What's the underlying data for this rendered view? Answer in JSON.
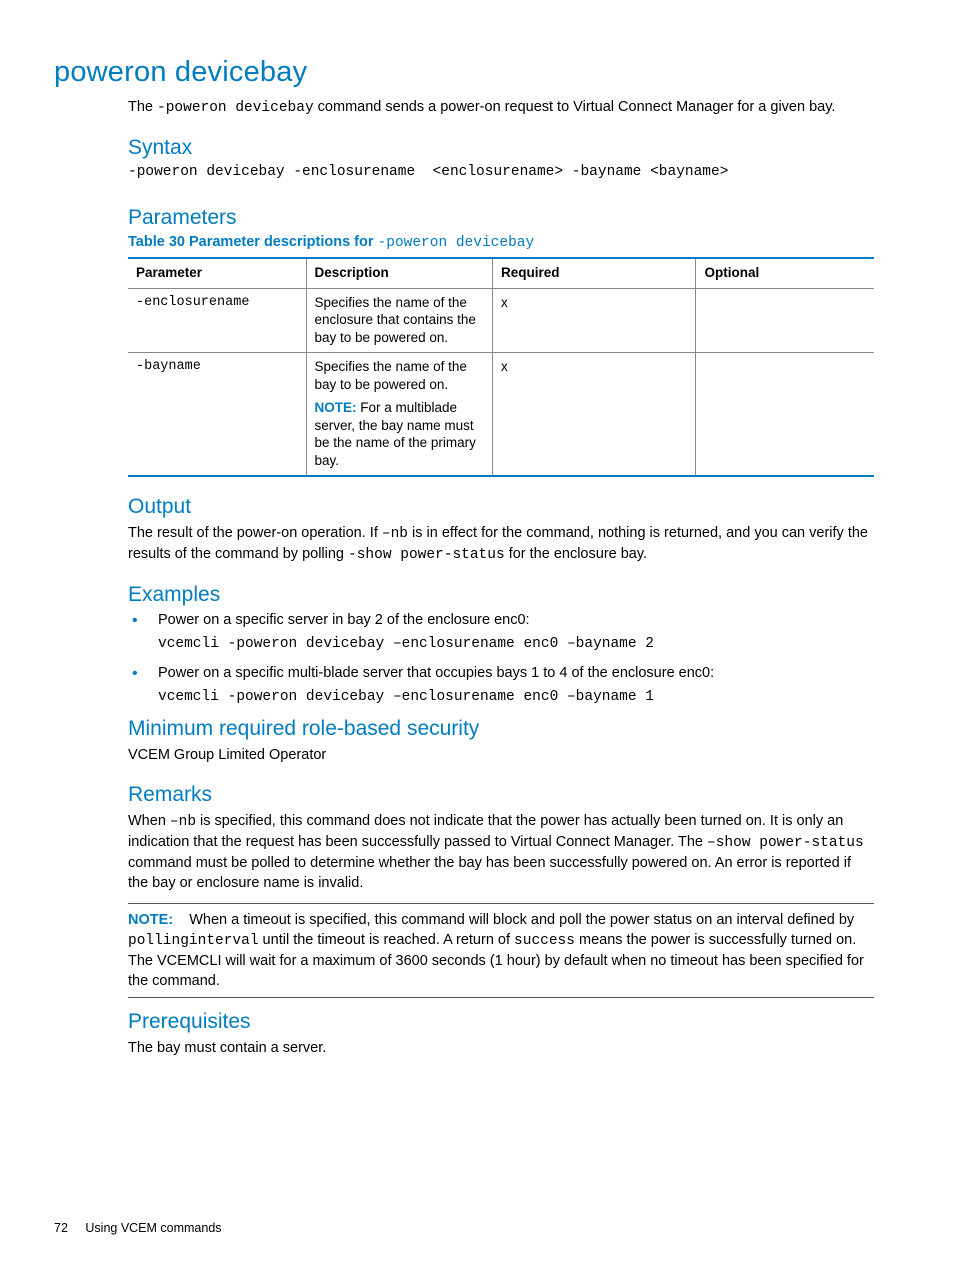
{
  "title": "poweron devicebay",
  "intro_pre": "The ",
  "intro_cmd": "-poweron devicebay",
  "intro_post": " command sends a power-on request to Virtual Connect Manager for a given bay.",
  "syntax": {
    "heading": "Syntax",
    "line": "-poweron devicebay -enclosurename  <enclosurename> -bayname <bayname>"
  },
  "parameters": {
    "heading": "Parameters",
    "caption_bold": "Table 30 Parameter descriptions for ",
    "caption_mono": "-poweron devicebay",
    "headers": {
      "param": "Parameter",
      "desc": "Description",
      "req": "Required",
      "opt": "Optional"
    },
    "rows": [
      {
        "param": "-enclosurename",
        "desc": "Specifies the name of the enclosure that contains the bay to be powered on.",
        "req": "x",
        "opt": ""
      },
      {
        "param": "-bayname",
        "desc": "Specifies the name of the bay to be powered on.",
        "note_label": "NOTE:",
        "note_text": " For a multiblade server, the bay name must be the name of the primary bay.",
        "req": "x",
        "opt": ""
      }
    ]
  },
  "output": {
    "heading": "Output",
    "p1": "The result of the power-on operation. If ",
    "p1_mono1": "–nb",
    "p2": " is in effect for the command, nothing is returned, and you can verify the results of the command by polling ",
    "p2_mono2": "-show power-status",
    "p3": " for the enclosure bay."
  },
  "examples": {
    "heading": "Examples",
    "items": [
      {
        "text": "Power on a specific server in bay 2 of the enclosure enc0:",
        "code": "vcemcli -poweron devicebay –enclosurename enc0 –bayname 2"
      },
      {
        "text": "Power on a specific multi-blade server that occupies bays 1 to 4 of the enclosure enc0:",
        "code": "vcemcli -poweron devicebay –enclosurename enc0 –bayname 1"
      }
    ]
  },
  "security": {
    "heading": "Minimum required role-based security",
    "text": "VCEM Group Limited Operator"
  },
  "remarks": {
    "heading": "Remarks",
    "p1a": "When ",
    "p1_mono1": "–nb",
    "p1b": " is specified, this command does not indicate that the power has actually been turned on. It is only an indication that the request has been successfully passed to Virtual Connect Manager. The ",
    "p1_mono2": "–show power-status",
    "p1c": " command must be polled to determine whether the bay has been successfully powered on. An error is reported if the bay or enclosure name is invalid."
  },
  "note": {
    "label": "NOTE:",
    "a": " When a timeout is specified, this command will block and poll the power status on an interval defined by ",
    "mono1": "pollinginterval",
    "b": " until the timeout is reached. A return of ",
    "mono2": "success",
    "c": " means the power is successfully turned on. The VCEMCLI will wait for a maximum of 3600 seconds (1 hour) by default when no timeout has been specified for the command."
  },
  "prerequisites": {
    "heading": "Prerequisites",
    "text": "The bay must contain a server."
  },
  "footer": {
    "page": "72",
    "chapter": "Using VCEM commands"
  }
}
